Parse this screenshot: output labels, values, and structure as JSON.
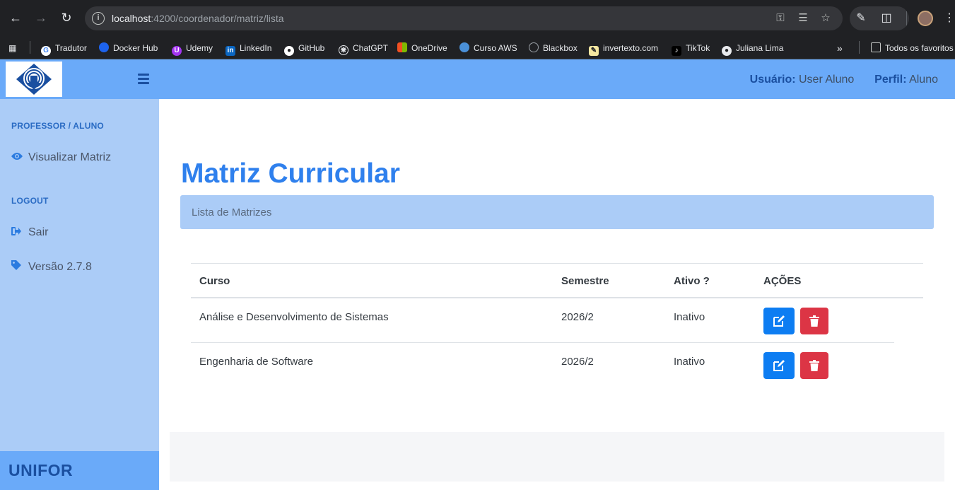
{
  "browser": {
    "url_host": "localhost",
    "url_path": ":4200/coordenador/matriz/lista",
    "bookmarks": [
      "Tradutor",
      "Docker Hub",
      "Udemy",
      "LinkedIn",
      "GitHub",
      "ChatGPT",
      "OneDrive",
      "Curso AWS",
      "Blackbox",
      "invertexto.com",
      "TikTok",
      "Juliana Lima"
    ],
    "all_bookmarks_label": "Todos os favoritos"
  },
  "header": {
    "user_label": "Usuário:",
    "user_value": "User Aluno",
    "profile_label": "Perfil:",
    "profile_value": "Aluno"
  },
  "sidebar": {
    "section1": "PROFESSOR / ALUNO",
    "item_view": "Visualizar Matriz",
    "section2": "LOGOUT",
    "item_logout": "Sair",
    "item_version": "Versão 2.7.8",
    "footer": "UNIFOR"
  },
  "main": {
    "title": "Matriz Curricular",
    "subtitle": "Lista de Matrizes",
    "columns": [
      "Curso",
      "Semestre",
      "Ativo ?",
      "AÇÕES"
    ],
    "rows": [
      {
        "curso": "Análise e Desenvolvimento de Sistemas",
        "semestre": "2026/2",
        "ativo": "Inativo"
      },
      {
        "curso": "Engenharia de Software",
        "semestre": "2026/2",
        "ativo": "Inativo"
      }
    ]
  },
  "colors": {
    "header_bg": "#6aaaf9",
    "sidebar_bg": "#abccf7",
    "title": "#2f80ed",
    "edit_button": "#0d7df2",
    "delete_button": "#dc3545"
  }
}
